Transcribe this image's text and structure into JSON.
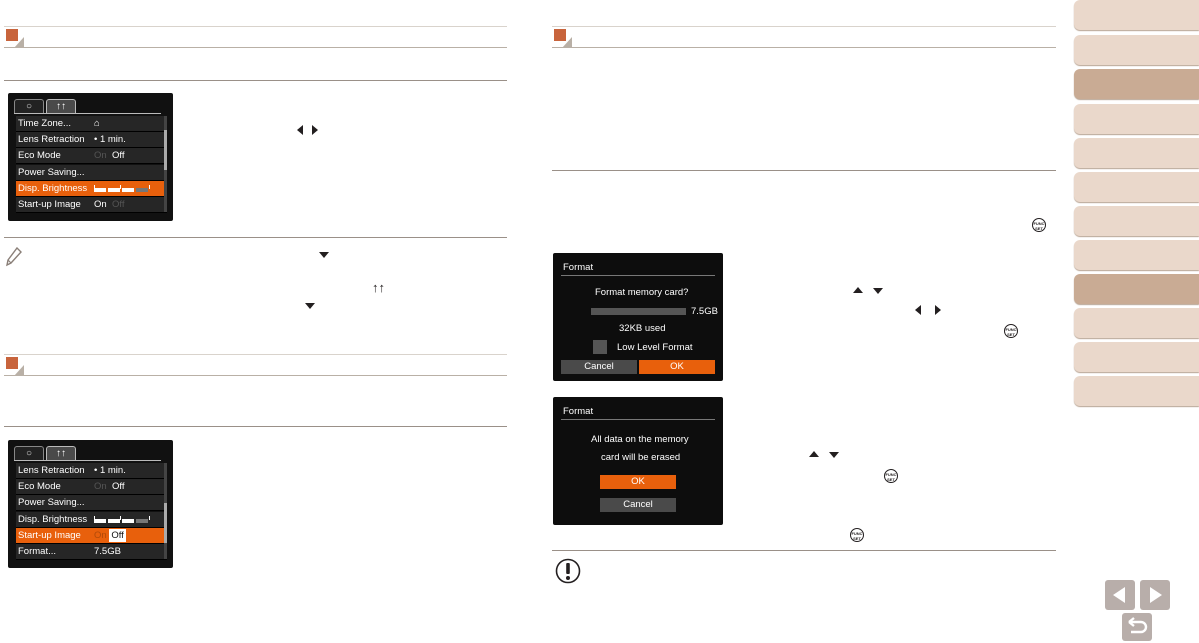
{
  "left_menu_1": {
    "tabs": [
      "camera-tab",
      "setup-tab"
    ],
    "rows": [
      {
        "label": "Time Zone...",
        "value": ""
      },
      {
        "label": "Lens Retraction",
        "value": "• 1 min."
      },
      {
        "label": "Eco Mode",
        "value_dim": "On",
        "value": "Off"
      },
      {
        "label": "Power Saving...",
        "value": ""
      },
      {
        "label": "Disp. Brightness",
        "value": ""
      },
      {
        "label": "Start-up Image",
        "value": "On",
        "value_dim": "Off"
      }
    ],
    "selected_row": "Disp. Brightness",
    "brightness_level": 3
  },
  "left_menu_2": {
    "tabs": [
      "camera-tab",
      "setup-tab"
    ],
    "rows": [
      {
        "label": "Lens Retraction",
        "value": "• 1 min."
      },
      {
        "label": "Eco Mode",
        "value_dim": "On",
        "value": "Off"
      },
      {
        "label": "Power Saving...",
        "value": ""
      },
      {
        "label": "Disp. Brightness",
        "value": ""
      },
      {
        "label": "Start-up Image",
        "value_dim": "On",
        "value": "Off"
      },
      {
        "label": "Format...",
        "value": "7.5GB"
      }
    ],
    "selected_row": "Start-up Image"
  },
  "format_dialog_1": {
    "title": "Format",
    "question": "Format memory card?",
    "capacity": "7.5GB",
    "used": "32KB used",
    "checkbox_label": "Low Level Format",
    "cancel": "Cancel",
    "ok": "OK"
  },
  "format_dialog_2": {
    "title": "Format",
    "line1": "All data on the memory",
    "line2": "card will be erased",
    "ok": "OK",
    "cancel": "Cancel"
  },
  "colors": {
    "accent": "#e8600c",
    "section_square": "#c8643c",
    "side_tab": "#ead8cb",
    "side_tab_active": "#c9ab94"
  },
  "icons": [
    "func-set-icon",
    "note-pencil-icon",
    "caution-icon",
    "setup-tab-icon",
    "home-icon"
  ]
}
